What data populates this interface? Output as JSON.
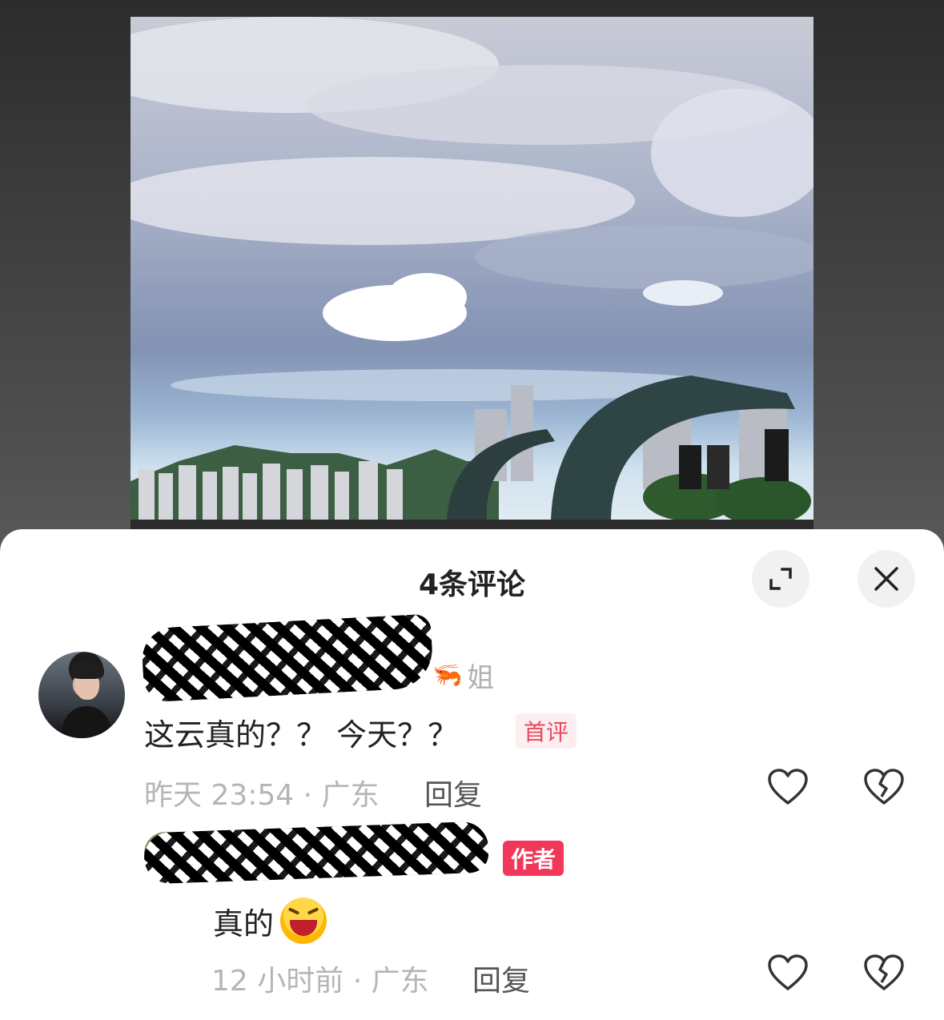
{
  "post": {
    "photo_description_icon": "cloud-harbour-photo"
  },
  "sheet": {
    "title": "4条评论",
    "expand_icon": "expand-icon",
    "close_icon": "close-icon"
  },
  "comments": [
    {
      "username_suffix": "姐",
      "badge_icon": "shrimp-icon",
      "text": "这云真的？？ 今天？？",
      "tag": "首评",
      "meta": "昨天 23:54 · 广东",
      "reply_label": "回复"
    },
    {
      "tag": "作者",
      "text": "真的",
      "emoji_icon": "laugh-icon",
      "meta": "12 小时前 · 广东",
      "reply_label": "回复"
    }
  ],
  "colors": {
    "accent": "#f2385a",
    "tag_first_bg": "#fdeef0",
    "meta": "#b5b5b5"
  }
}
